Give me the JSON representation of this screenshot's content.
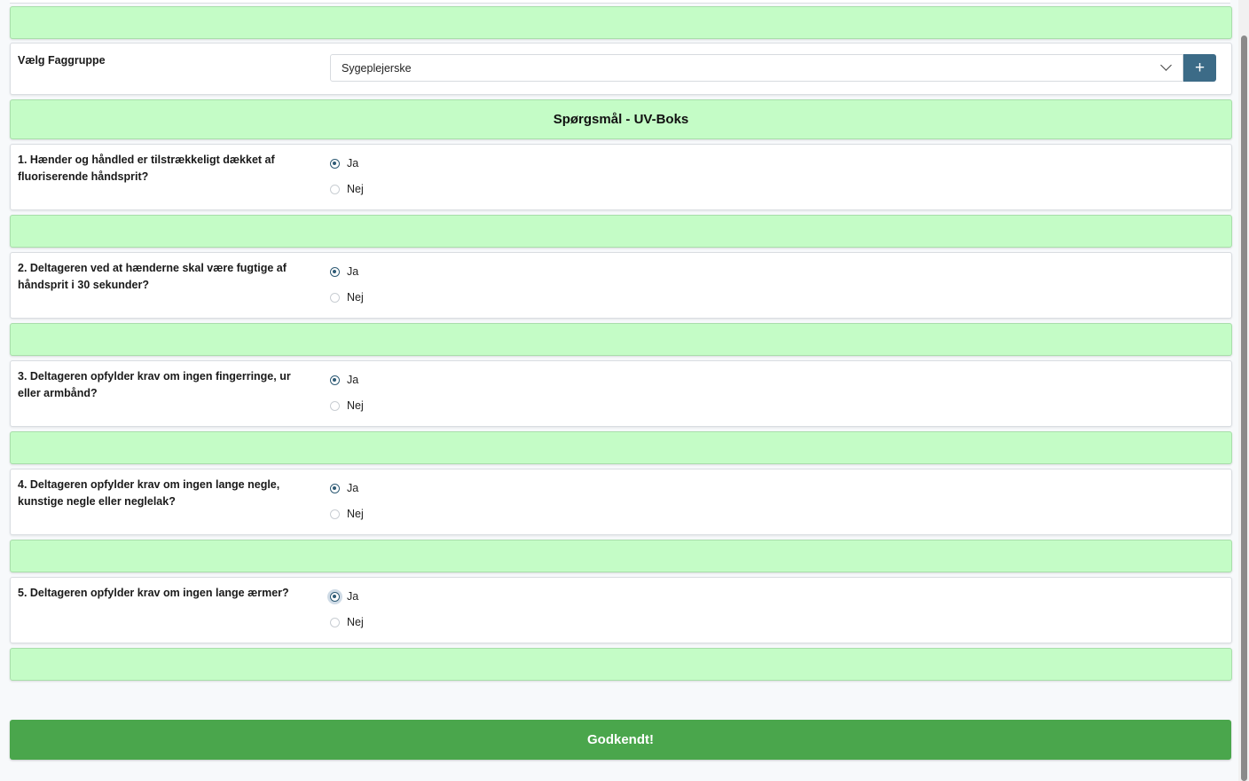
{
  "faggruppe": {
    "label": "Vælg Faggruppe",
    "selected": "Sygeplejerske",
    "add_button": "+"
  },
  "section_title": "Spørgsmål - UV-Boks",
  "options": {
    "yes": "Ja",
    "no": "Nej"
  },
  "questions": [
    {
      "text": "1. Hænder og håndled er tilstrækkeligt dækket af fluoriserende håndsprit?",
      "answer": "Ja"
    },
    {
      "text": "2. Deltageren ved at hænderne skal være fugtige af håndsprit i 30 sekunder?",
      "answer": "Ja"
    },
    {
      "text": "3. Deltageren opfylder krav om ingen fingerringe, ur eller armbånd?",
      "answer": "Ja"
    },
    {
      "text": "4. Deltageren opfylder krav om ingen lange negle, kunstige negle eller neglelak?",
      "answer": "Ja"
    },
    {
      "text": "5. Deltageren opfylder krav om ingen lange ærmer?",
      "answer": "Ja"
    }
  ],
  "submit_label": "Godkendt!",
  "colors": {
    "band": "#c4fcc6",
    "accent": "#3c6b87",
    "submit": "#4aa64c"
  }
}
